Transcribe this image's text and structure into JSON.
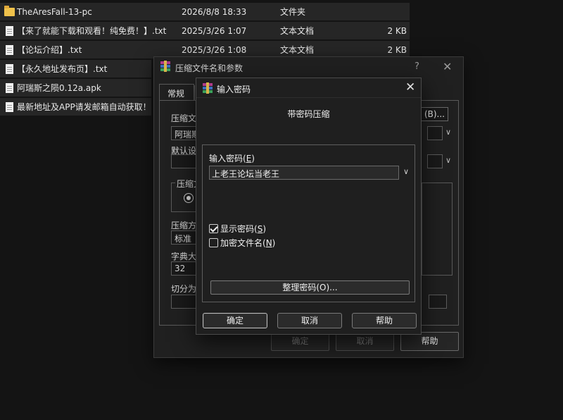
{
  "files": [
    {
      "name": "TheAresFall-13-pc",
      "date": "2026/8/8 18:33",
      "type": "文件夹",
      "size": "",
      "icon": "folder-icon"
    },
    {
      "name": "【来了就能下载和观看！纯免费！】.txt",
      "date": "2025/3/26 1:07",
      "type": "文本文档",
      "size": "2 KB",
      "icon": "text-file-icon"
    },
    {
      "name": "【论坛介绍】.txt",
      "date": "2025/3/26 1:08",
      "type": "文本文档",
      "size": "2 KB",
      "icon": "text-file-icon"
    },
    {
      "name": "【永久地址发布页】.txt",
      "date": "",
      "type": "",
      "size": "",
      "icon": "text-file-icon"
    },
    {
      "name": "阿瑞斯之陨0.12a.apk",
      "date": "",
      "type": "",
      "size": "",
      "icon": "file-icon"
    },
    {
      "name": "最新地址及APP请发邮箱自动获取！！",
      "date": "",
      "type": "",
      "size": "",
      "icon": "text-file-icon"
    }
  ],
  "back_dialog": {
    "title": "压缩文件名和参数",
    "help": "?",
    "tab_general": "常规",
    "label_archive": "压缩文",
    "archive_value": "阿瑞斯",
    "browse_button": "(B)...",
    "label_default": "默认设",
    "group_format": "压缩文",
    "label_method": "压缩方",
    "method_value": "标准",
    "label_dict": "字典大",
    "dict_value": "32",
    "label_split": "切分为",
    "ok": "确定",
    "cancel": "取消",
    "help_button": "帮助"
  },
  "password_dialog": {
    "title": "输入密码",
    "heading": "带密码压缩",
    "label_prefix": "输入密码(",
    "label_key": "E",
    "label_suffix": ")",
    "password_value": "上老王论坛当老王",
    "show_password": {
      "prefix": "显示密码(",
      "key": "S",
      "suffix": ")",
      "checked": true
    },
    "encrypt_names": {
      "prefix": "加密文件名(",
      "key": "N",
      "suffix": ")",
      "checked": false
    },
    "organize_button": "整理密码(O)...",
    "ok": "确定",
    "cancel": "取消",
    "help": "帮助"
  },
  "colors": {
    "background": "#141414",
    "dialog": "#1f1f1f",
    "folder": "#f0c24b",
    "text": "#f0f0f0"
  }
}
